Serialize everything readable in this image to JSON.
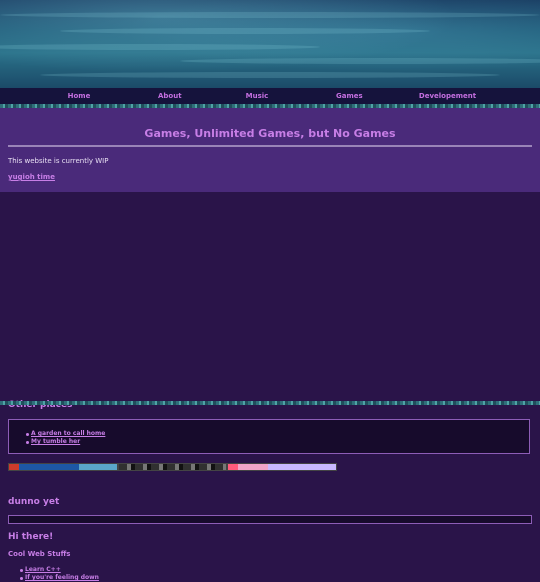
{
  "nav": [
    "Home",
    "About",
    "Music",
    "Games",
    "Developement"
  ],
  "intro": {
    "title": "Games, Unlimited Games, but No Games",
    "wip": "This website is currently WIP",
    "link": "yugioh time"
  },
  "other_places": {
    "heading": "Other places",
    "links": [
      "A garden to call home",
      "My tumble her"
    ]
  },
  "dunno": {
    "heading": "dunno yet"
  },
  "hi": {
    "heading": "Hi there!",
    "subheading": "Cool Web Stuffs",
    "links": [
      "Learn C++",
      "If you're feeling down"
    ]
  },
  "colors": {
    "accent": "#c77ee6",
    "nav_bg": "#15133c",
    "intro_bg": "#4a2a7a",
    "page_bg": "#2a1449"
  }
}
